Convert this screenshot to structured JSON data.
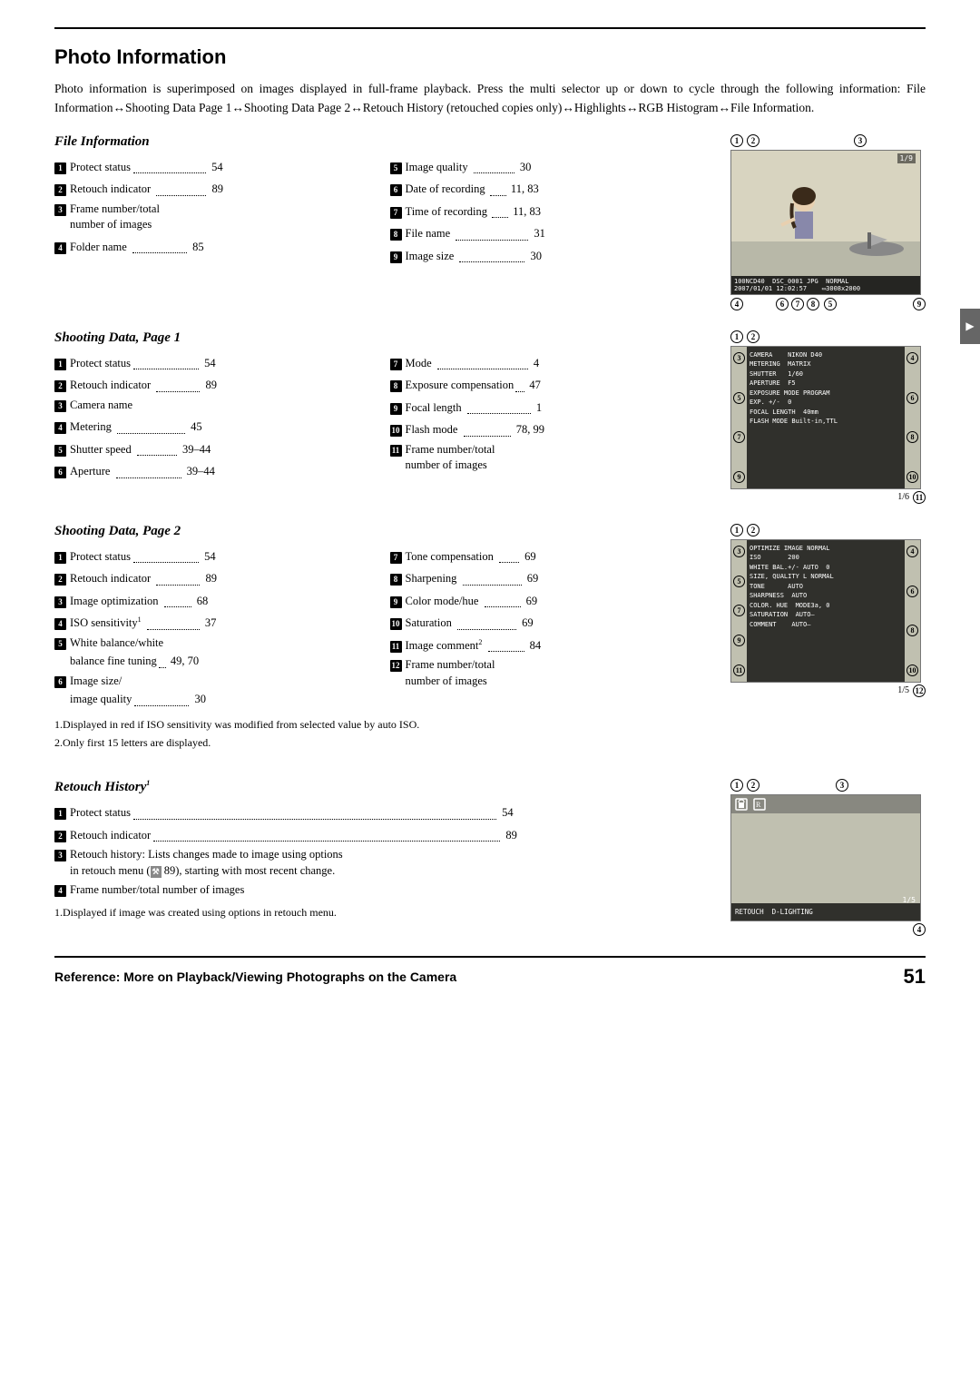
{
  "page": {
    "top_border": true,
    "title": "Photo Information",
    "intro": "Photo information is superimposed on images displayed in full-frame playback. Press the multi selector up or down to cycle through the following information: File Information↔Shooting Data Page 1↔Shooting Data Page 2↔Retouch History (retouched copies only)↔Highlights↔RGB Histogram↔File Information.",
    "bottom_label": "Reference: More on Playback/Viewing Photographs on the Camera",
    "page_number": "51"
  },
  "file_information": {
    "title": "File Information",
    "col1": [
      {
        "num": "1",
        "text": "Protect status",
        "dots": true,
        "page": "54"
      },
      {
        "num": "2",
        "text": "Retouch indicator",
        "dots": true,
        "page": "89"
      },
      {
        "num": "3",
        "text": "Frame number/total\nnumber of images",
        "dots": false,
        "page": ""
      },
      {
        "num": "4",
        "text": "Folder name",
        "dots": true,
        "page": "85"
      }
    ],
    "col2": [
      {
        "num": "5",
        "text": "Image quality",
        "dots": true,
        "page": "30"
      },
      {
        "num": "6",
        "text": "Date of recording",
        "dots": true,
        "page": "11, 83"
      },
      {
        "num": "7",
        "text": "Time of recording",
        "dots": true,
        "page": "11, 83"
      },
      {
        "num": "8",
        "text": "File name",
        "dots": true,
        "page": "31"
      },
      {
        "num": "9",
        "text": "Image size",
        "dots": true,
        "page": "30"
      }
    ]
  },
  "shooting_data_page1": {
    "title": "Shooting Data, Page 1",
    "col1": [
      {
        "num": "1",
        "text": "Protect status",
        "dots": true,
        "page": "54"
      },
      {
        "num": "2",
        "text": "Retouch indicator",
        "dots": true,
        "page": "89"
      },
      {
        "num": "3",
        "text": "Camera name",
        "dots": false,
        "page": ""
      },
      {
        "num": "4",
        "text": "Metering",
        "dots": true,
        "page": "45"
      },
      {
        "num": "5",
        "text": "Shutter speed",
        "dots": true,
        "page": "39–44"
      },
      {
        "num": "6",
        "text": "Aperture",
        "dots": true,
        "page": "39–44"
      }
    ],
    "col2": [
      {
        "num": "7",
        "text": "Mode",
        "dots": true,
        "page": "4"
      },
      {
        "num": "8",
        "text": "Exposure compensation",
        "dots": true,
        "page": "47"
      },
      {
        "num": "9",
        "text": "Focal length",
        "dots": true,
        "page": "1"
      },
      {
        "num": "10",
        "text": "Flash mode",
        "dots": true,
        "page": "78, 99"
      },
      {
        "num": "11",
        "text": "Frame number/total\nnumber of images",
        "dots": false,
        "page": ""
      }
    ]
  },
  "shooting_data_page2": {
    "title": "Shooting Data, Page 2",
    "col1": [
      {
        "num": "1",
        "text": "Protect status",
        "dots": true,
        "page": "54"
      },
      {
        "num": "2",
        "text": "Retouch indicator",
        "dots": true,
        "page": "89"
      },
      {
        "num": "3",
        "text": "Image optimization",
        "dots": true,
        "page": "68"
      },
      {
        "num": "4",
        "text": "ISO sensitivity¹",
        "dots": true,
        "page": "37"
      },
      {
        "num": "5",
        "text": "White balance/white\nbalance fine tuning",
        "dots": true,
        "page": "49, 70"
      },
      {
        "num": "6",
        "text": "Image size/\nimage quality",
        "dots": true,
        "page": "30"
      }
    ],
    "col2": [
      {
        "num": "7",
        "text": "Tone compensation",
        "dots": true,
        "page": "69"
      },
      {
        "num": "8",
        "text": "Sharpening",
        "dots": true,
        "page": "69"
      },
      {
        "num": "9",
        "text": "Color mode/hue",
        "dots": true,
        "page": "69"
      },
      {
        "num": "10",
        "text": "Saturation",
        "dots": true,
        "page": "69"
      },
      {
        "num": "11",
        "text": "Image comment²",
        "dots": true,
        "page": "84"
      },
      {
        "num": "12",
        "text": "Frame number/total\nnumber of images",
        "dots": false,
        "page": ""
      }
    ],
    "footnotes": [
      "1.Displayed in red if ISO sensitivity was modified from selected value by auto ISO.",
      "2.Only first 15 letters are displayed."
    ]
  },
  "retouch_history": {
    "title": "Retouch History¹",
    "items": [
      {
        "num": "1",
        "text": "Protect status",
        "dots": true,
        "page": "54"
      },
      {
        "num": "2",
        "text": "Retouch indicator",
        "dots": true,
        "page": "89"
      },
      {
        "num": "3",
        "text": "Retouch history: Lists changes made to image using options\nin retouch menu (  89), starting with most recent change.",
        "dots": false
      },
      {
        "num": "4",
        "text": "Frame number/total number of images",
        "dots": false
      }
    ],
    "footnote": "1.Displayed if image was created using options in retouch menu."
  },
  "screen1": {
    "badges_top": [
      "1",
      "2",
      "3"
    ],
    "badges_bottom": [
      "4",
      "5",
      "6",
      "7",
      "8",
      "9"
    ],
    "data_line": "100NCD40  DSC_0001 JPG  NORMAL",
    "data_line2": "2007/01/01  12:02:57     3008x2000",
    "frame_count": "1/9"
  },
  "screen2": {
    "badges_row1": [
      "1",
      "2"
    ],
    "badges_side": [
      "3",
      "4",
      "5",
      "6",
      "7",
      "8",
      "9",
      "10"
    ],
    "camera_data": [
      "CAMERA    NIKON D40",
      "METERING  MATRIX",
      "SHUTTER   1/60",
      "APERTURE  F5",
      "EXPOSURE MODE  PROGRAM",
      "EXP. +/-  0",
      "FOCAL LENGTH  40mm",
      "FLASH MODE  Built-in,TTL"
    ],
    "frame_count": "1/6",
    "badge11": "11"
  },
  "screen3": {
    "badges_row1": [
      "1",
      "2"
    ],
    "badges_side": [
      "3",
      "4",
      "5",
      "6",
      "7",
      "8",
      "9",
      "10"
    ],
    "camera_data": [
      "OPTIMIZE IMAGE NORMAL",
      "ISO       200",
      "WHITE BAL.+/-  AUTO   0",
      "SIZE, QUALITY  L NORMAL",
      "TONE      AUTO",
      "SHARPNESS  AUTO",
      "COLOR. HUE  MODE3a, 0",
      "SATURATION  AUTO—",
      "COMMENT   AUTO—"
    ],
    "frame_count": "1/5",
    "badge12": "12"
  },
  "screen4": {
    "badges_top": [
      "1",
      "2",
      "3"
    ],
    "data": "RETOUCH   D-LIGHTING",
    "frame_count": "1/5",
    "badge4": "4"
  }
}
